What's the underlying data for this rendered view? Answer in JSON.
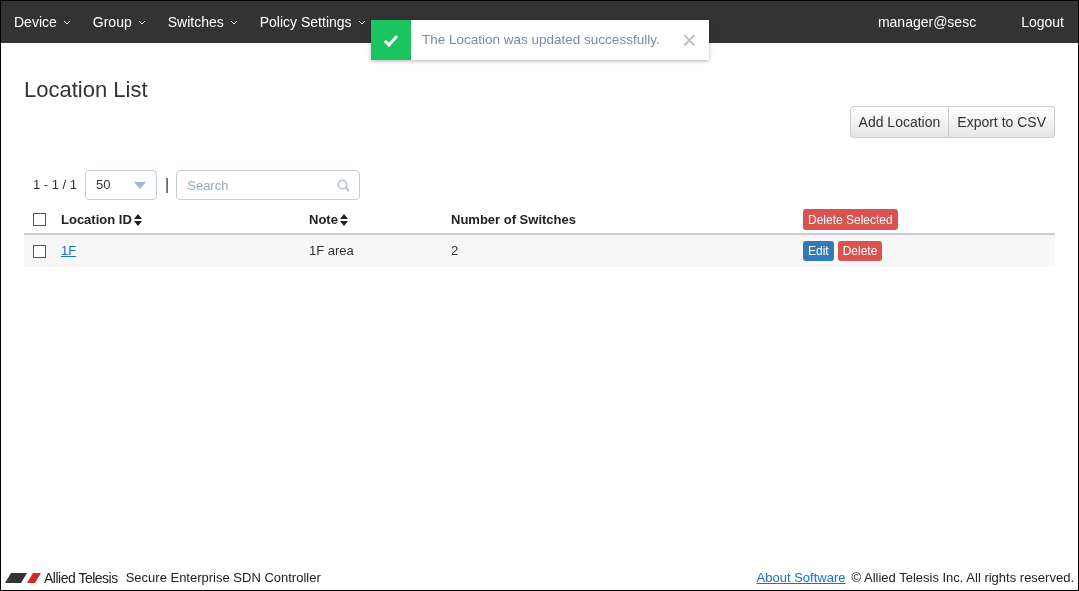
{
  "nav": {
    "items": [
      {
        "label": "Device"
      },
      {
        "label": "Group"
      },
      {
        "label": "Switches"
      },
      {
        "label": "Policy Settings"
      }
    ],
    "user": "manager@sesc",
    "logout": "Logout"
  },
  "toast": {
    "message": "The Location was updated successfully.",
    "close": "×"
  },
  "page": {
    "title": "Location List",
    "buttons": [
      "Add Location",
      "Export to CSV"
    ]
  },
  "pager": {
    "range": "1 - 1 / 1",
    "page_size": "50",
    "separator": "|",
    "search_placeholder": "Search"
  },
  "table": {
    "select_all_checked": false,
    "columns": [
      {
        "label": "Location ID",
        "sortable": true
      },
      {
        "label": "Note",
        "sortable": true
      },
      {
        "label": "Number of Switches",
        "sortable": false
      }
    ],
    "delete_selected": "Delete Selected",
    "rows": [
      {
        "checked": false,
        "location_id": "1F",
        "note": "1F area",
        "switches": "2",
        "edit": "Edit",
        "delete": "Delete"
      }
    ]
  },
  "footer": {
    "brand": "Allied Telesis",
    "product": "Secure Enterprise SDN Controller",
    "about": "About Software",
    "copyright": "© Allied Telesis Inc. All rights reserved."
  }
}
